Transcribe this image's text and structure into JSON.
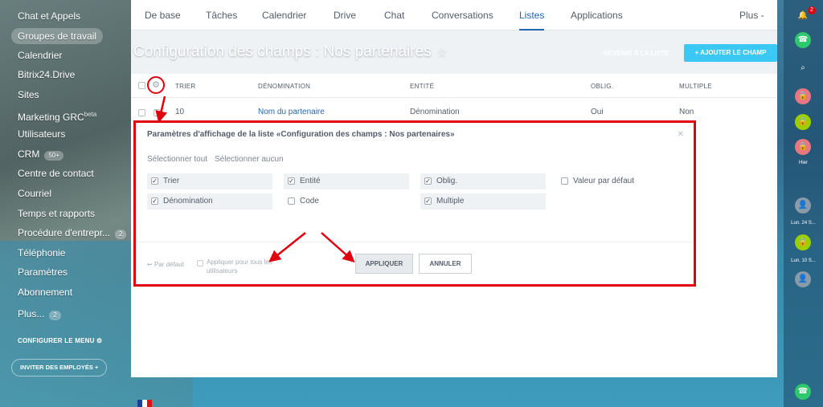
{
  "sidebar": {
    "items": [
      {
        "label": "Chat et Appels",
        "sup": ""
      },
      {
        "label": "Groupes de travail",
        "sup": ""
      },
      {
        "label": "Calendrier",
        "sup": ""
      },
      {
        "label": "Bitrix24.Drive",
        "sup": ""
      },
      {
        "label": "Sites",
        "sup": ""
      },
      {
        "label": "Marketing GRC",
        "sup": "beta"
      },
      {
        "label": "Utilisateurs",
        "sup": ""
      },
      {
        "label": "CRM",
        "sup": ""
      },
      {
        "label": "Centre de contact",
        "sup": ""
      },
      {
        "label": "Courriel",
        "sup": ""
      },
      {
        "label": "Temps et rapports",
        "sup": ""
      },
      {
        "label": "Procédure d'entrepr...",
        "sup": ""
      },
      {
        "label": "Téléphonie",
        "sup": ""
      },
      {
        "label": "Paramètres",
        "sup": ""
      },
      {
        "label": "Abonnement",
        "sup": ""
      },
      {
        "label": "Plus...",
        "sup": ""
      }
    ],
    "crm_badge": "50+",
    "procedure_badge": "2",
    "plus_badge": "2",
    "configure_menu": "CONFIGURER LE MENU",
    "invite": "INVITER DES EMPLOYÉS"
  },
  "topnav": {
    "items": [
      "De base",
      "Tâches",
      "Calendrier",
      "Drive",
      "Chat",
      "Conversations",
      "Listes",
      "Applications"
    ],
    "more": "Plus -"
  },
  "page": {
    "title": "Configuration des champs : Nos partenaires",
    "back": "REVENIR À LA LISTE",
    "add": "AJOUTER LE CHAMP"
  },
  "grid": {
    "headers": [
      "TRIER",
      "DÉNOMINATION",
      "ENTITÉ",
      "OBLIG.",
      "MULTIPLE"
    ],
    "row": [
      "10",
      "Nom du partenaire",
      "Dénomination",
      "Oui",
      "Non"
    ]
  },
  "modal": {
    "title": "Paramètres d'affichage de la liste «Configuration des champs : Nos partenaires»",
    "select_all": "Sélectionner tout",
    "select_none": "Sélectionner aucun",
    "fields": [
      {
        "label": "Trier",
        "checked": true
      },
      {
        "label": "Entité",
        "checked": true
      },
      {
        "label": "Oblig.",
        "checked": true
      },
      {
        "label": "Valeur par défaut",
        "checked": false
      },
      {
        "label": "Dénomination",
        "checked": true
      },
      {
        "label": "Code",
        "checked": false
      },
      {
        "label": "Multiple",
        "checked": true
      }
    ],
    "default": "Par défaut",
    "apply_all": "Appliquer pour tous les utilisateurs",
    "apply": "APPLIQUER",
    "cancel": "ANNULER"
  },
  "rightbar": {
    "notif_count": "2",
    "yesterday": "Hier",
    "date1": "Lun. 24 S...",
    "date2": "Lun. 10 S..."
  },
  "colors": {
    "accent": "#2067b0",
    "highlight": "#e0000e",
    "add_button": "#3bc8f5"
  }
}
